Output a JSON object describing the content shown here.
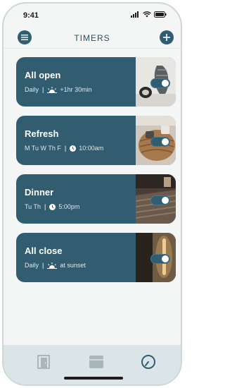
{
  "status": {
    "time": "9:41"
  },
  "header": {
    "title": "TIMERS",
    "menu_icon": "menu-icon",
    "add_icon": "plus-icon"
  },
  "timers": [
    {
      "name": "All open",
      "days": "Daily",
      "trigger_icon": "sunrise-icon",
      "time": "+1hr 30min",
      "enabled": true
    },
    {
      "name": "Refresh",
      "days": "M Tu W Th F",
      "trigger_icon": "clock-icon",
      "time": "10:00am",
      "enabled": true
    },
    {
      "name": "Dinner",
      "days": "Tu Th",
      "trigger_icon": "clock-icon",
      "time": "5:00pm",
      "enabled": true
    },
    {
      "name": "All close",
      "days": "Daily",
      "trigger_icon": "sunset-icon",
      "time": "at sunset",
      "enabled": true
    }
  ],
  "tabs": [
    {
      "icon": "door-icon",
      "active": false
    },
    {
      "icon": "blinds-icon",
      "active": false
    },
    {
      "icon": "clock-icon",
      "active": true
    }
  ],
  "colors": {
    "accent": "#325d70",
    "tabbar": "#dbe4e7"
  }
}
